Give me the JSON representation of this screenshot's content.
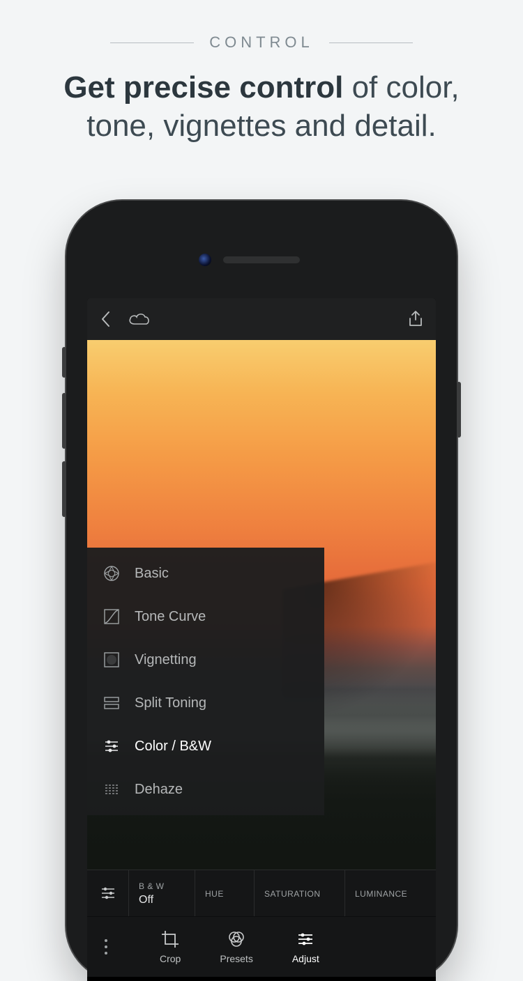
{
  "promo": {
    "eyebrow": "CONTROL",
    "headline_bold": "Get precise control",
    "headline_rest": " of color, tone, vignettes and detail."
  },
  "topbar": {
    "back_icon": "back-chevron",
    "cloud_icon": "cloud",
    "share_icon": "share"
  },
  "adjust_menu": {
    "items": [
      {
        "label": "Basic",
        "icon": "aperture-icon",
        "active": false
      },
      {
        "label": "Tone Curve",
        "icon": "tone-curve-icon",
        "active": false
      },
      {
        "label": "Vignetting",
        "icon": "vignette-icon",
        "active": false
      },
      {
        "label": "Split Toning",
        "icon": "split-toning-icon",
        "active": false
      },
      {
        "label": "Color / B&W",
        "icon": "sliders-icon",
        "active": true
      },
      {
        "label": "Dehaze",
        "icon": "dehaze-icon",
        "active": false
      }
    ]
  },
  "param_bar": {
    "lead_icon": "sliders-icon",
    "cells": [
      {
        "label": "B & W",
        "value": "Off"
      },
      {
        "label": "HUE",
        "value": ""
      },
      {
        "label": "SATURATION",
        "value": ""
      },
      {
        "label": "LUMINANCE",
        "value": ""
      }
    ]
  },
  "bottom_nav": {
    "items": [
      {
        "label": "Crop",
        "icon": "crop-icon",
        "active": false
      },
      {
        "label": "Presets",
        "icon": "presets-icon",
        "active": false
      },
      {
        "label": "Adjust",
        "icon": "adjust-icon",
        "active": true
      }
    ]
  }
}
